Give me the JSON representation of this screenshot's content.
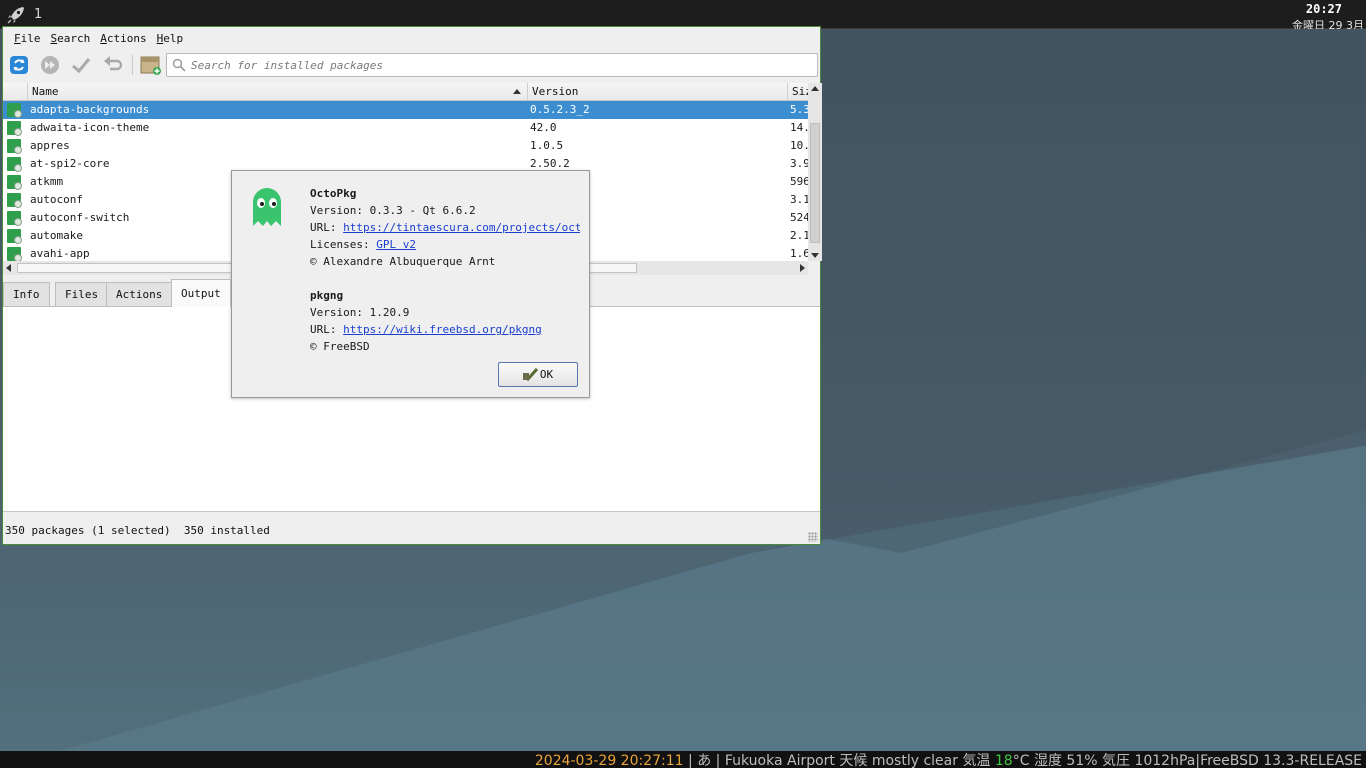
{
  "top_panel": {
    "workspace": "1",
    "time": "20:27",
    "date": "金曜日 29 3月"
  },
  "bottom_panel": {
    "datetime": "2024-03-29 20:27:11",
    "input_method": "あ",
    "location": "Fukuoka Airport",
    "weather_label": "天候",
    "weather": "mostly clear",
    "temp_label": "気温",
    "temp_value": "18",
    "temp_unit": "°C",
    "humidity_label": "湿度",
    "humidity": "51%",
    "pressure_label": "気圧",
    "pressure": "1012hPa",
    "os": "FreeBSD 13.3-RELEASE",
    "separator": "|",
    "colors": {
      "datetime": "#e8a33a",
      "temp": "#3fc43f"
    }
  },
  "menubar": {
    "items": [
      {
        "label": "File",
        "underline": "F",
        "rest": "ile"
      },
      {
        "label": "Search",
        "underline": "S",
        "rest": "earch"
      },
      {
        "label": "Actions",
        "underline": "A",
        "rest": "ctions"
      },
      {
        "label": "Help",
        "underline": "H",
        "rest": "elp"
      }
    ]
  },
  "toolbar": {
    "search_placeholder": "Search for installed packages",
    "search_value": ""
  },
  "table": {
    "columns": [
      "Name",
      "Version",
      "Siz"
    ],
    "sort": "ascending",
    "rows": [
      {
        "name": "adapta-backgrounds",
        "version": "0.5.2.3_2",
        "size": "5.3",
        "selected": true
      },
      {
        "name": "adwaita-icon-theme",
        "version": "42.0",
        "size": "14."
      },
      {
        "name": "appres",
        "version": "1.0.5",
        "size": "10."
      },
      {
        "name": "at-spi2-core",
        "version": "2.50.2",
        "size": "3.9"
      },
      {
        "name": "atkmm",
        "version": "",
        "size": "596"
      },
      {
        "name": "autoconf",
        "version": "",
        "size": "3.1"
      },
      {
        "name": "autoconf-switch",
        "version": "",
        "size": "524"
      },
      {
        "name": "automake",
        "version": "",
        "size": "2.1"
      },
      {
        "name": "avahi-app",
        "version": "",
        "size": "1.6"
      }
    ]
  },
  "tabs": [
    "Info",
    "Files",
    "Actions",
    "Output"
  ],
  "active_tab": "Output",
  "status": {
    "packages": "350 packages (1 selected)",
    "installed": "350 installed"
  },
  "about_dialog": {
    "app_name": "OctoPkg",
    "app_version": "Version: 0.3.3 - Qt 6.6.2",
    "url_label": "URL:",
    "app_url": "https://tintaescura.com/projects/octopkg",
    "licenses_label": "Licenses:",
    "license": "GPL v2",
    "app_copyright": "© Alexandre Albuquerque Arnt",
    "backend_name": "pkgng",
    "backend_version": "Version: 1.20.9",
    "backend_url": "https://wiki.freebsd.org/pkgng",
    "backend_copyright": "© FreeBSD",
    "ok_label": "OK"
  }
}
